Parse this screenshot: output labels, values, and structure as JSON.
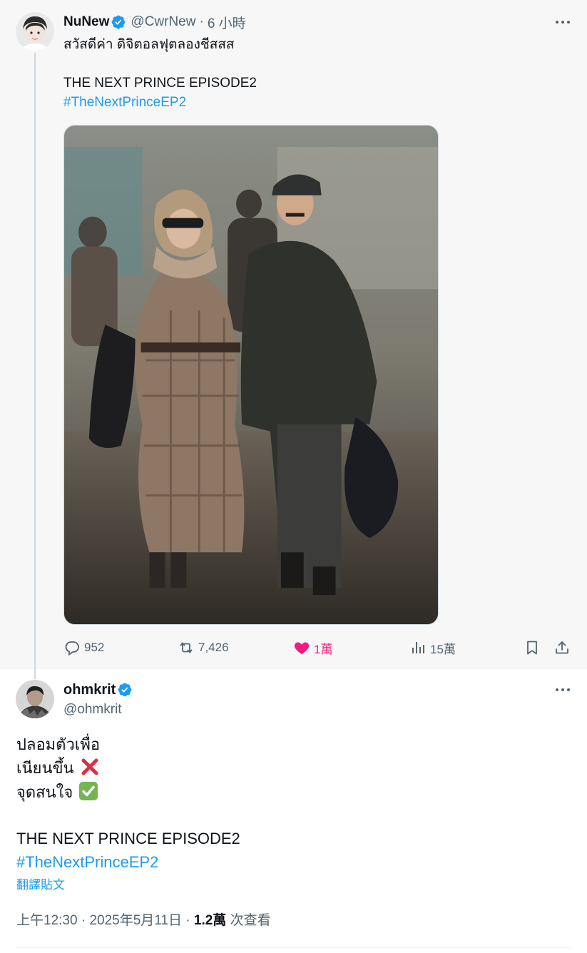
{
  "parent_tweet": {
    "display_name": "NuNew",
    "handle": "@CwrNew",
    "time": "6 小時",
    "separator": "·",
    "text_line1": "สวัสดีค่า ดิจิตอลฟุตลองชีสสส",
    "text_line2": "THE NEXT PRINCE EPISODE2",
    "hashtag": "#TheNextPrinceEP2",
    "actions": {
      "replies": "952",
      "retweets": "7,426",
      "likes": "1萬",
      "views": "15萬"
    }
  },
  "main_tweet": {
    "display_name": "ohmkrit",
    "handle": "@ohmkrit",
    "line1": "ปลอมตัวเพื่อ",
    "line2": "เนียนขึ้น",
    "line3": "จุดสนใจ",
    "line4": "THE NEXT PRINCE EPISODE2",
    "hashtag": "#TheNextPrinceEP2",
    "translate": "翻譯貼文",
    "time": "上午12:30",
    "date": "2025年5月11日",
    "sep": "·",
    "views_count": "1.2萬",
    "views_label": "次查看"
  },
  "colors": {
    "accent": "#1d9bf0",
    "like": "#f91880",
    "muted": "#536471",
    "parent_bg": "#f7f7f7"
  },
  "icons": [
    "verified-badge-icon",
    "more-icon",
    "reply-icon",
    "retweet-icon",
    "heart-icon",
    "views-icon",
    "bookmark-icon",
    "share-icon",
    "cross-mark-icon",
    "check-mark-icon"
  ]
}
